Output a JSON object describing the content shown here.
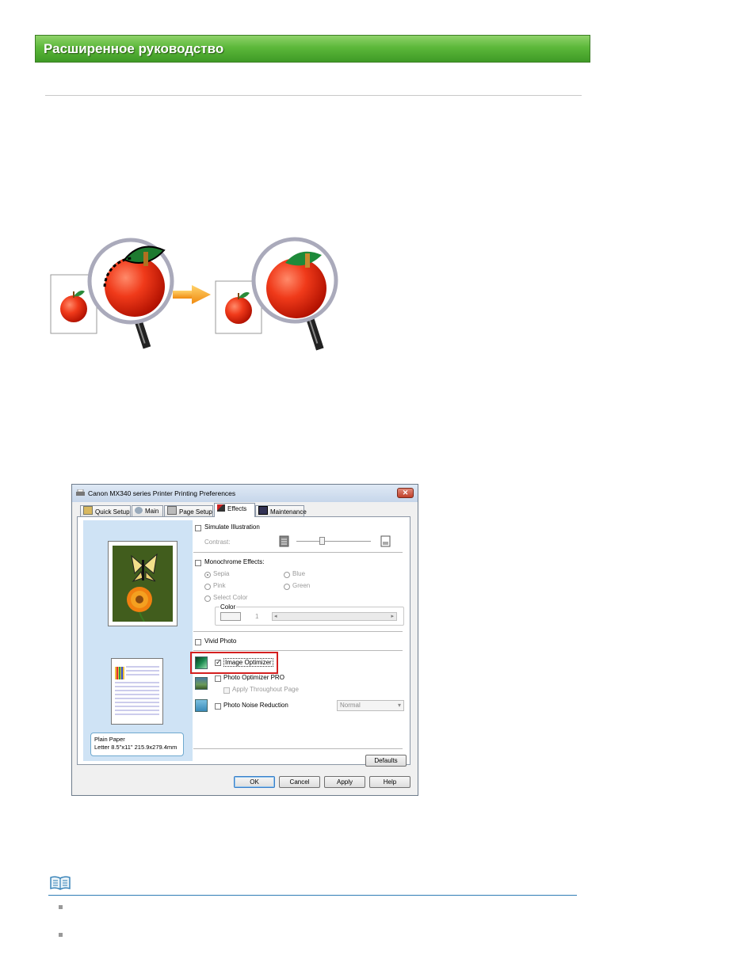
{
  "header": {
    "title": "Расширенное руководство",
    "accent_color": "#5cb83a"
  },
  "illustration": {
    "description_icons": [
      "apple-icon",
      "magnifier-icon",
      "arrow-right-icon"
    ]
  },
  "dialog": {
    "title": "Canon MX340 series Printer Printing Preferences",
    "close_label": "✕",
    "tabs": [
      {
        "label": "Quick Setup",
        "active": false
      },
      {
        "label": "Main",
        "active": false
      },
      {
        "label": "Page Setup",
        "active": false
      },
      {
        "label": "Effects",
        "active": true
      },
      {
        "label": "Maintenance",
        "active": false
      }
    ],
    "preview": {
      "paper_type": "Plain Paper",
      "paper_size": "Letter 8.5\"x11\" 215.9x279.4mm"
    },
    "simulate_illustration": {
      "label": "Simulate Illustration",
      "checked": false,
      "contrast_label": "Contrast:"
    },
    "monochrome": {
      "label": "Monochrome Effects:",
      "checked": false,
      "options": {
        "sepia": "Sepia",
        "blue": "Blue",
        "pink": "Pink",
        "green": "Green",
        "select_color": "Select Color"
      },
      "color_label": "Color",
      "color_value": "1"
    },
    "vivid_photo": {
      "label": "Vivid Photo",
      "checked": false
    },
    "image_optimizer": {
      "label": "Image Optimizer",
      "checked": true,
      "highlight_color": "#d42020"
    },
    "photo_optimizer_pro": {
      "label": "Photo Optimizer PRO",
      "checked": false,
      "apply_label": "Apply Throughout Page"
    },
    "photo_noise_reduction": {
      "label": "Photo Noise Reduction",
      "checked": false,
      "level": "Normal"
    },
    "buttons": {
      "defaults": "Defaults",
      "ok": "OK",
      "cancel": "Cancel",
      "apply": "Apply",
      "help": "Help"
    }
  },
  "note": {
    "icon": "note-book-icon",
    "rule_color": "#2f7db5"
  }
}
